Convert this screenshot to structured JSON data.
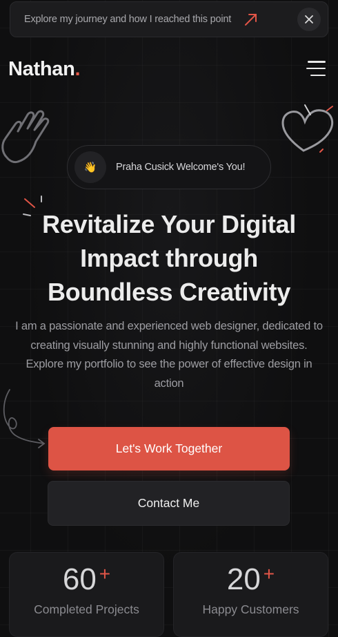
{
  "announcement": {
    "text": "Explore my journey and how I reached this point",
    "arrow_icon": "arrow-up-right-icon",
    "close_icon": "close-icon"
  },
  "header": {
    "logo_text": "Nathan",
    "logo_dot": ".",
    "menu_icon": "hamburger-menu-icon"
  },
  "badge": {
    "emoji": "👋",
    "text": "Praha Cusick Welcome's You!"
  },
  "hero": {
    "title_line1": "Revitalize Your Digital",
    "title_line2": "Impact through",
    "title_line3": "Boundless Creativity",
    "description": "I am a passionate and experienced web designer, dedicated to creating visually stunning and highly functional websites. Explore my portfolio to see the power of effective design in action"
  },
  "buttons": {
    "primary_label": "Let's Work Together",
    "secondary_label": "Contact Me"
  },
  "stats": [
    {
      "value": "60",
      "plus": "+",
      "label": "Completed Projects"
    },
    {
      "value": "20",
      "plus": "+",
      "label": "Happy Customers"
    }
  ],
  "colors": {
    "accent": "#dd5445",
    "background": "#0f0f10",
    "card": "#1a1a1c"
  }
}
